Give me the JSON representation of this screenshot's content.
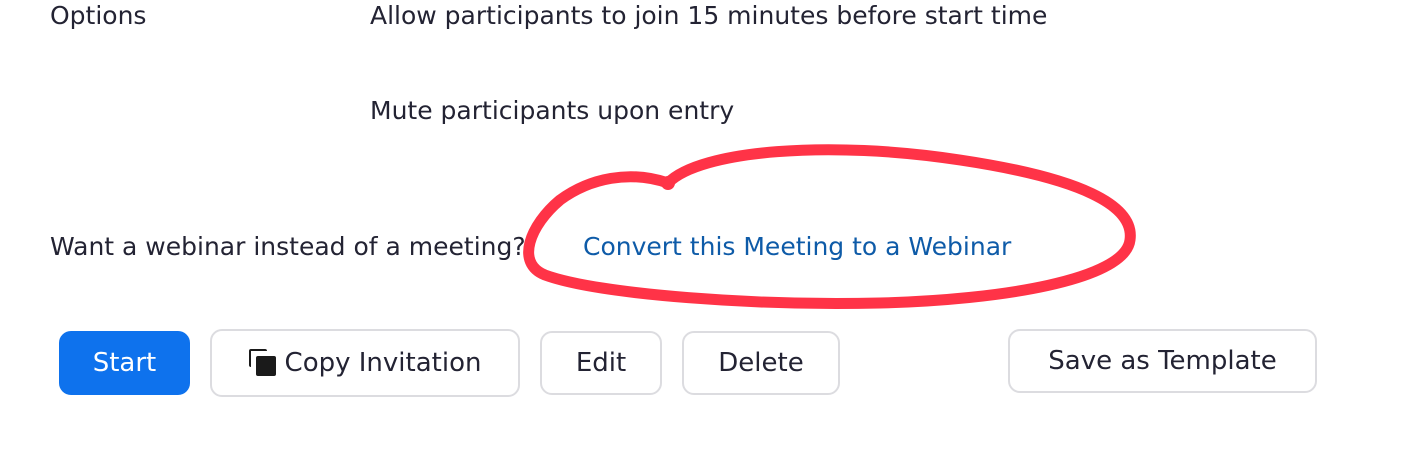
{
  "options": {
    "label": "Options",
    "items": [
      "Allow participants to join 15 minutes before start time",
      "Mute participants upon entry"
    ]
  },
  "webinar": {
    "prompt": "Want a webinar instead of a meeting?",
    "link": "Convert this Meeting to a Webinar"
  },
  "actions": {
    "start": "Start",
    "copy": "Copy Invitation",
    "edit": "Edit",
    "delete": "Delete",
    "save_template": "Save as Template"
  },
  "icons": {
    "copy": "copy-icon"
  },
  "colors": {
    "primary": "#0e72ed",
    "link": "#0e5ba8",
    "annotation": "#ff3347"
  }
}
